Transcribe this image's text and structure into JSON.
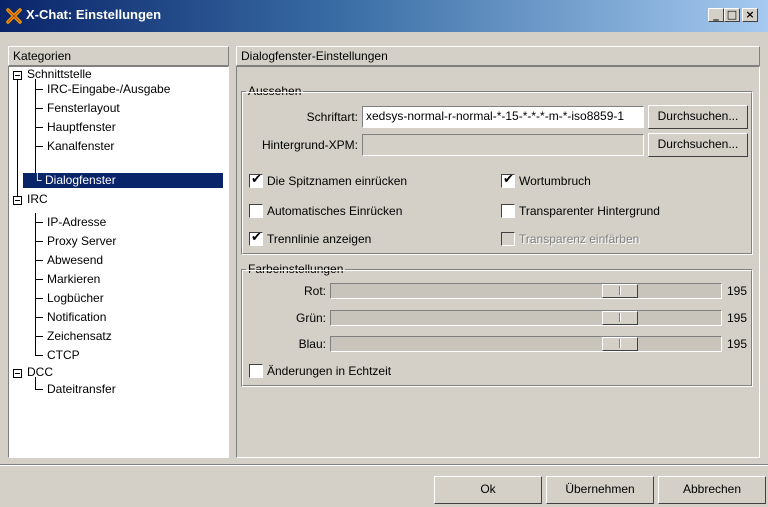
{
  "window": {
    "title": "X-Chat: Einstellungen",
    "icon": "xchat-icon",
    "minimize": "_",
    "maximize": "□",
    "close": "×"
  },
  "sidebar": {
    "header": "Kategorien",
    "groups": [
      {
        "label": "Schnittstelle",
        "items": [
          "IRC-Eingabe-/Ausgabe",
          "Fensterlayout",
          "Hauptfenster",
          "Kanalfenster",
          "Dialogfenster"
        ]
      },
      {
        "label": "IRC",
        "items": [
          "IP-Adresse",
          "Proxy Server",
          "Abwesend",
          "Markieren",
          "Logbücher",
          "Notification",
          "Zeichensatz",
          "CTCP"
        ]
      },
      {
        "label": "DCC",
        "items": [
          "Dateitransfer"
        ]
      }
    ],
    "selected": "Dialogfenster"
  },
  "main": {
    "header": "Dialogfenster-Einstellungen",
    "appearance": {
      "title": "Aussehen",
      "font_label": "Schriftart:",
      "font_value": "xedsys-normal-r-normal-*-15-*-*-*-m-*-iso8859-1",
      "font_browse": "Durchsuchen...",
      "bg_label": "Hintergrund-XPM:",
      "bg_value": "",
      "bg_browse": "Durchsuchen...",
      "check_indent_nicks": "Die Spitznamen einrücken",
      "check_indent_nicks_checked": true,
      "check_word_wrap": "Wortumbruch",
      "check_word_wrap_checked": true,
      "check_auto_indent": "Automatisches Einrücken",
      "check_auto_indent_checked": false,
      "check_transparent": "Transparenter Hintergrund",
      "check_transparent_checked": false,
      "check_separator": "Trennlinie anzeigen",
      "check_separator_checked": true,
      "check_tint": "Transparenz einfärben",
      "check_tint_checked": false,
      "check_tint_enabled": false,
      "check_mark": "✔"
    },
    "colors": {
      "title": "Farbeinstellungen",
      "red_label": "Rot:",
      "red_value": "195",
      "green_label": "Grün:",
      "green_value": "195",
      "blue_label": "Blau:",
      "blue_value": "195",
      "slider_max": 255,
      "check_realtime": "Änderungen in Echtzeit",
      "check_realtime_checked": false
    }
  },
  "footer": {
    "ok": "Ok",
    "apply": "Übernehmen",
    "cancel": "Abbrechen"
  },
  "colors": {
    "face": "#d4d0c8",
    "selection": "#0a246a",
    "title_start": "#0a246a",
    "title_end": "#a6caf0",
    "xchat_orange": "#f0a000"
  }
}
